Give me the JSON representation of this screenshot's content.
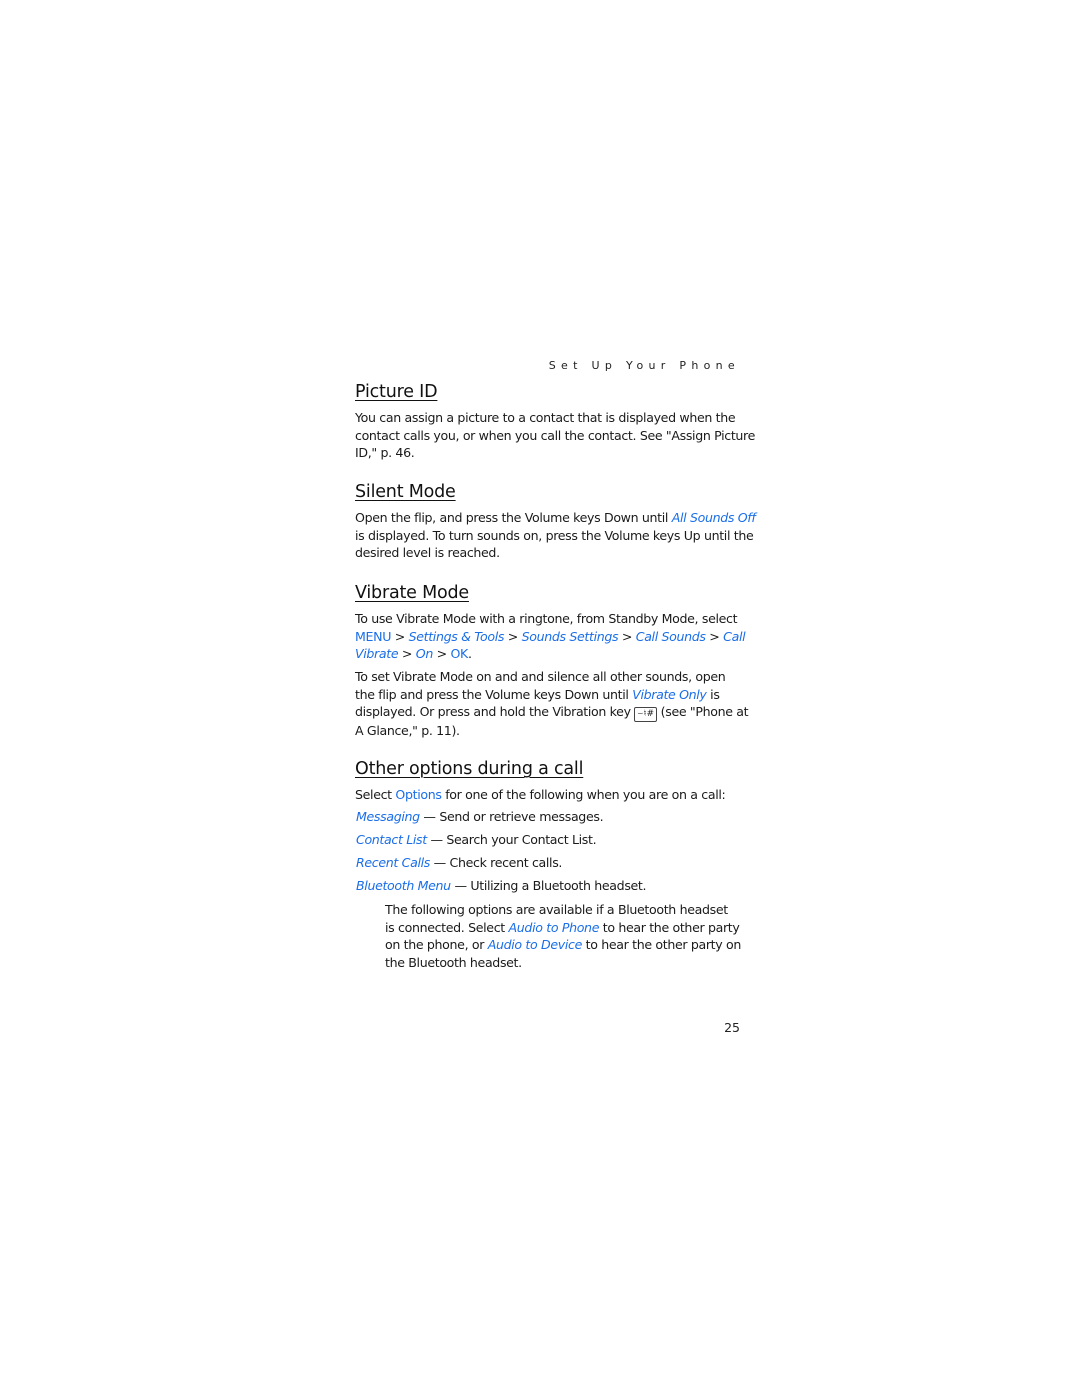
{
  "running_head": "Set Up Your Phone",
  "page_number": "25",
  "sections": {
    "picture_id": {
      "title": "Picture ID",
      "lines": [
        "You can assign a picture to a contact that is displayed when the",
        "contact calls you, or when you call the contact. See \"Assign Picture",
        "ID,\" p. 46."
      ]
    },
    "silent_mode": {
      "title": "Silent Mode",
      "line1_pre": "Open the flip, and press the Volume keys Down until ",
      "line1_link": "All Sounds Off",
      "line2": "is displayed. To turn sounds on, press the Volume keys Up until the",
      "line3": "desired level is reached."
    },
    "vibrate_mode": {
      "title": "Vibrate Mode",
      "p1_line1": "To use Vibrate Mode with a ringtone, from Standby Mode, select",
      "path": {
        "menu": "MENU",
        "sep": " > ",
        "settings_tools": "Settings & Tools",
        "sounds_settings": "Sounds Settings",
        "call_sounds": "Call Sounds",
        "call": "Call",
        "vibrate": "Vibrate",
        "on": "On",
        "ok": "OK",
        "end": "."
      },
      "p2_line1": "To set Vibrate Mode on and and silence all other sounds, open",
      "p2_line2_pre": "the flip and press the Volume keys Down until ",
      "p2_line2_link": "Vibrate Only",
      "p2_line2_post": " is",
      "p2_line3_pre": "displayed. Or press and hold the Vibration key ",
      "vibration_key_glyph": "⌣♮#",
      "p2_line3_post": " (see \"Phone at",
      "p2_line4": "A Glance,\" p. 11)."
    },
    "other_options": {
      "title": "Other options during a call",
      "intro_pre": "Select ",
      "intro_link": "Options",
      "intro_post": " for one of the following when you are on a call:",
      "items": [
        {
          "label": "Messaging",
          "desc": " — Send or retrieve messages."
        },
        {
          "label": "Contact List",
          "desc": " — Search your Contact List."
        },
        {
          "label": "Recent Calls",
          "desc": " — Check recent calls."
        },
        {
          "label": "Bluetooth Menu",
          "desc": " — Utilizing a Bluetooth headset."
        }
      ],
      "bt_line1": "The following options are available if a Bluetooth headset",
      "bt_line2_pre": "is connected. Select ",
      "bt_line2_link": "Audio to Phone",
      "bt_line2_post": " to hear the other party",
      "bt_line3_pre": "on the phone, or ",
      "bt_line3_link": "Audio to Device",
      "bt_line3_post": " to hear the other party on",
      "bt_line4": "the Bluetooth headset."
    }
  }
}
